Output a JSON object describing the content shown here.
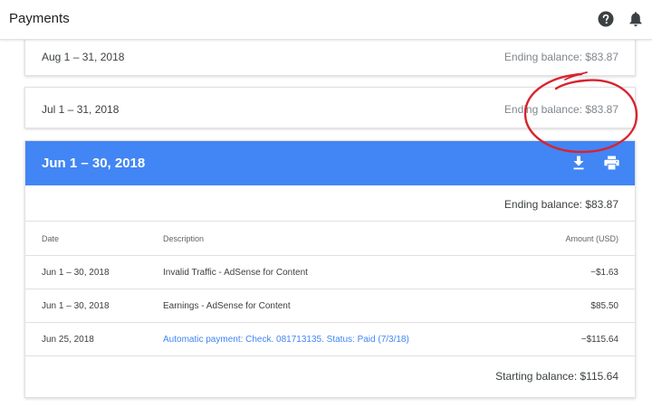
{
  "header": {
    "title": "Payments",
    "icons": [
      "help-icon",
      "bell-icon"
    ]
  },
  "statements": [
    {
      "period": "Aug 1 – 31, 2018",
      "ending_balance_text": "Ending balance: $83.87",
      "expanded": false
    },
    {
      "period": "Jul 1 – 31, 2018",
      "ending_balance_text": "Ending balance: $83.87",
      "expanded": false
    },
    {
      "period": "Jun 1 – 30, 2018",
      "ending_balance_text": "Ending balance: $83.87",
      "expanded": true,
      "columns": {
        "date": "Date",
        "description": "Description",
        "amount": "Amount (USD)"
      },
      "rows": [
        {
          "date": "Jun 1 – 30, 2018",
          "description": "Invalid Traffic - AdSense for Content",
          "amount": "−$1.63"
        },
        {
          "date": "Jun 1 – 30, 2018",
          "description": "Earnings - AdSense for Content",
          "amount": "$85.50"
        },
        {
          "date": "Jun 25, 2018",
          "description": "Automatic payment: Check. 081713135. Status: Paid (7/3/18)",
          "amount": "−$115.64"
        }
      ],
      "starting_balance_text": "Starting balance: $115.64"
    }
  ],
  "colors": {
    "accent_blue": "#4285f4",
    "annotation_red": "#d9232e",
    "text_primary": "#3c4043",
    "text_muted": "#80868b"
  }
}
